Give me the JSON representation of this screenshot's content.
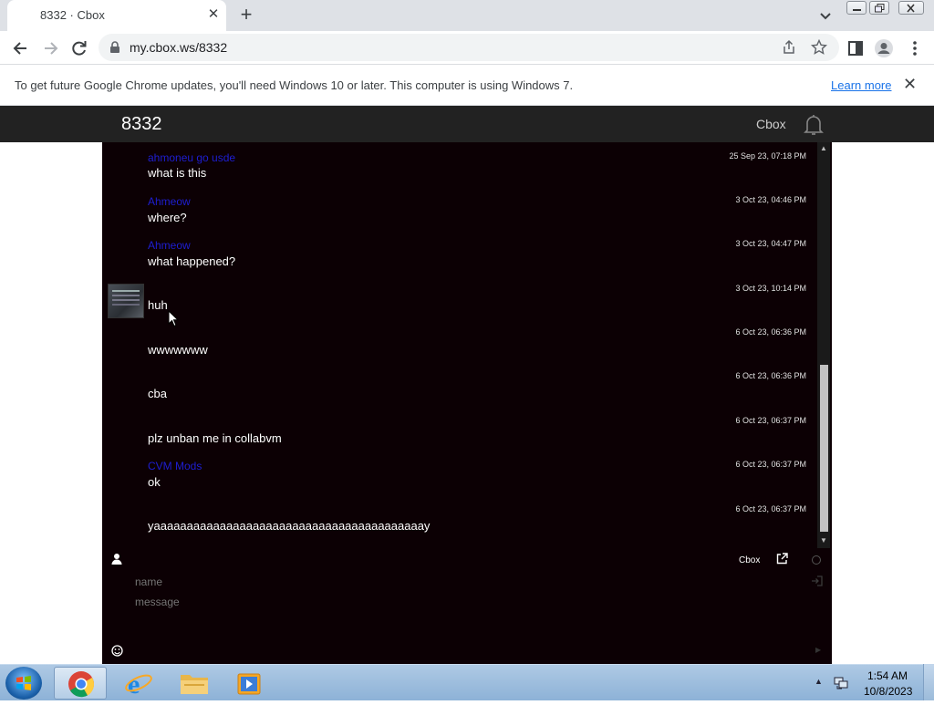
{
  "browser": {
    "tab_title": "8332 · Cbox",
    "tab_close": "✕",
    "new_tab": "+",
    "url": "my.cbox.ws/8332"
  },
  "infobar": {
    "message": "To get future Google Chrome updates, you'll need Windows 10 or later. This computer is using Windows 7.",
    "learn_more": "Learn more",
    "close": "✕"
  },
  "cbox": {
    "box_name": "8332",
    "brand": "Cbox",
    "messages": [
      {
        "user": "ahmoneu go usde",
        "text": "what is this",
        "time": "25 Sep 23, 07:18 PM"
      },
      {
        "user": "Ahmeow",
        "text": "where?",
        "time": "3 Oct 23, 04:46 PM"
      },
      {
        "user": "Ahmeow",
        "text": "what happened?",
        "time": "3 Oct 23, 04:47 PM"
      },
      {
        "user": "",
        "text": "huh",
        "time": "3 Oct 23, 10:14 PM"
      },
      {
        "user": "",
        "text": "wwwwwww",
        "time": "6 Oct 23, 06:36 PM"
      },
      {
        "user": "",
        "text": "cba",
        "time": "6 Oct 23, 06:36 PM"
      },
      {
        "user": "",
        "text": "plz unban me in collabvm",
        "time": "6 Oct 23, 06:37 PM"
      },
      {
        "user": "CVM Mods",
        "text": "ok",
        "time": "6 Oct 23, 06:37 PM"
      },
      {
        "user": "",
        "text": "yaaaaaaaaaaaaaaaaaaaaaaaaaaaaaaaaaaaaaaaaay",
        "time": "6 Oct 23, 06:37 PM"
      }
    ],
    "composer": {
      "cbox_link": "Cbox",
      "name_placeholder": "name",
      "message_placeholder": "message"
    }
  },
  "taskbar": {
    "time": "1:54 AM",
    "date": "10/8/2023"
  },
  "colors": {
    "chat_bg": "#0c0004",
    "username": "#1e1ed2",
    "header_bg": "#222222",
    "link": "#1a73e8"
  }
}
